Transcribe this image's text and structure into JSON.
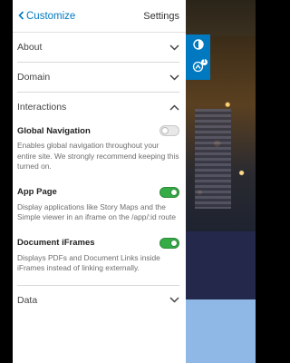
{
  "header": {
    "back_label": "Customize",
    "title": "Settings"
  },
  "sections": {
    "about": {
      "label": "About"
    },
    "domain": {
      "label": "Domain"
    },
    "interactions": {
      "label": "Interactions",
      "items": [
        {
          "label": "Global Navigation",
          "description": "Enables global navigation throughout your entire site. We strongly recommend keeping this turned on.",
          "enabled": false
        },
        {
          "label": "App Page",
          "description": "Display applications like Story Maps and the Simple viewer in an iframe on the /app/:id route",
          "enabled": true
        },
        {
          "label": "Document iFrames",
          "description": "Displays PDFs and Document Links inside iFrames instead of linking externally.",
          "enabled": true
        }
      ]
    },
    "data": {
      "label": "Data"
    }
  },
  "tools": {
    "badge_count": "1"
  },
  "colors": {
    "accent": "#0079c1",
    "toggle_on": "#35ac46"
  }
}
